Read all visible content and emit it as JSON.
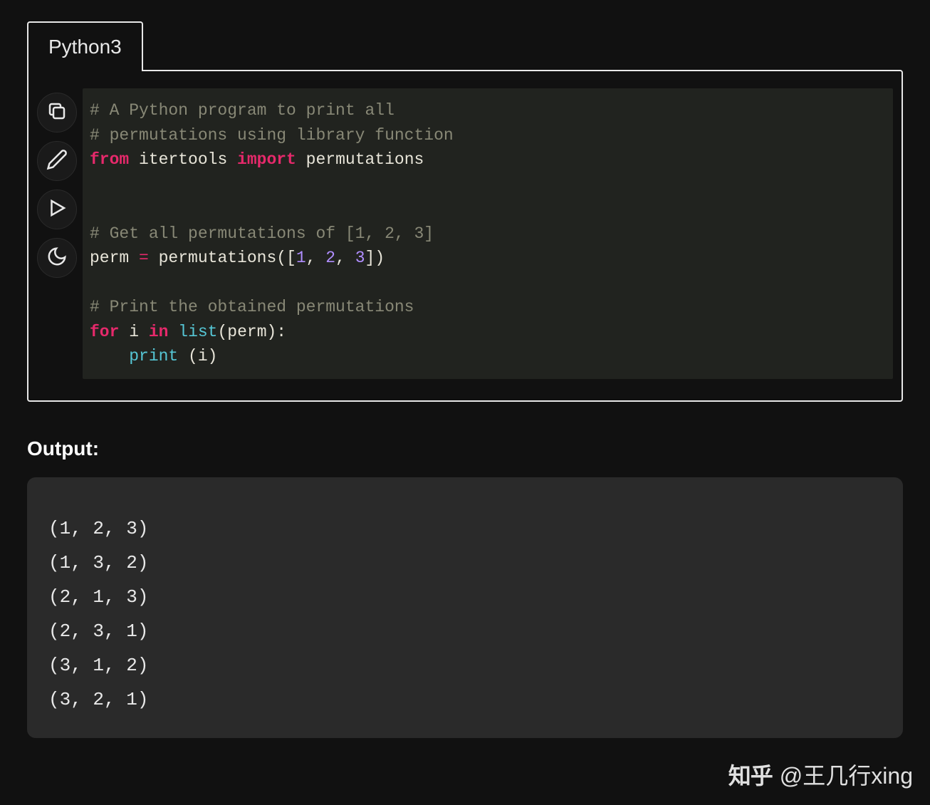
{
  "tab_label": "Python3",
  "icons": {
    "copy": "copy-icon",
    "edit": "edit-icon",
    "run": "play-icon",
    "theme": "moon-icon"
  },
  "code": {
    "line1_comment": "# A Python program to print all",
    "line2_comment": "# permutations using library function",
    "line3_from": "from",
    "line3_module": " itertools ",
    "line3_import": "import",
    "line3_name": " permutations",
    "line5_comment": "# Get all permutations of [1, 2, 3]",
    "line6_var": "perm ",
    "line6_eq": "=",
    "line6_call": " permutations([",
    "line6_n1": "1",
    "line6_c1": ", ",
    "line6_n2": "2",
    "line6_c2": ", ",
    "line6_n3": "3",
    "line6_end": "])",
    "line8_comment": "# Print the obtained permutations",
    "line9_for": "for",
    "line9_i": " i ",
    "line9_in": "in",
    "line9_sp": " ",
    "line9_list": "list",
    "line9_perm": "(perm):",
    "line10_indent": "    ",
    "line10_print": "print",
    "line10_arg": " (i)"
  },
  "output_label": "Output:",
  "output_lines": [
    "(1, 2, 3)",
    "(1, 3, 2)",
    "(2, 1, 3)",
    "(2, 3, 1)",
    "(3, 1, 2)",
    "(3, 2, 1)"
  ],
  "watermark": {
    "logo": "知乎",
    "text": "@王几行xing"
  }
}
